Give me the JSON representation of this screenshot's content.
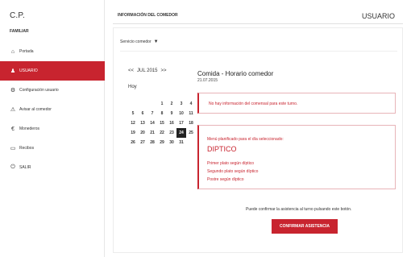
{
  "brand": {
    "title": "C.P.",
    "subtitle": "FAMILIAR"
  },
  "sidebar": {
    "items": [
      {
        "label": "Portada",
        "icon": "home-icon",
        "glyph": "⌂"
      },
      {
        "label": "USUARIO",
        "icon": "user-icon",
        "glyph": "♟"
      },
      {
        "label": "Configuración usuario",
        "icon": "gear-icon",
        "glyph": "⚙"
      },
      {
        "label": "Avisar al comedor",
        "icon": "alert-icon",
        "glyph": "⚠"
      },
      {
        "label": "Monederos",
        "icon": "coin-icon",
        "glyph": "€"
      },
      {
        "label": "Recibos",
        "icon": "receipt-icon",
        "glyph": "▭"
      },
      {
        "label": "SALIR",
        "icon": "power-icon",
        "glyph": "⏻"
      }
    ],
    "active_index": 1,
    "accent": "#c8242f"
  },
  "header": {
    "title": "INFORMACIÓN DEL COMEDOR",
    "user": "USUARIO"
  },
  "main": {
    "select_label": "Servicio comedor",
    "calendar": {
      "prev": "<<",
      "month": "JUL 2015",
      "next": ">>",
      "today": "Hoy",
      "selected": "24",
      "days": [
        "",
        "",
        "",
        "1",
        "2",
        "3",
        "4",
        "5",
        "6",
        "7",
        "8",
        "9",
        "10",
        "11",
        "12",
        "13",
        "14",
        "15",
        "16",
        "17",
        "18",
        "19",
        "20",
        "21",
        "22",
        "23",
        "24",
        "25",
        "26",
        "27",
        "28",
        "29",
        "30",
        "31",
        ""
      ]
    },
    "content_title": "Comida - Horario comedor",
    "content_date": "21.07.2015",
    "alert_text": "No hay información del comensal para este turno.",
    "menu": {
      "intro": "Menú planificado para el día seleccionado:",
      "type": "DIPTICO",
      "dishes": [
        "Primer plato según díptico",
        "Segundo plato según díptico",
        "Postre según díptico"
      ]
    },
    "confirm_text": "Puede confirmar la asistencia al turno pulsando este botón.",
    "confirm_button": "CONFIRMAR ASISTENCIA"
  }
}
